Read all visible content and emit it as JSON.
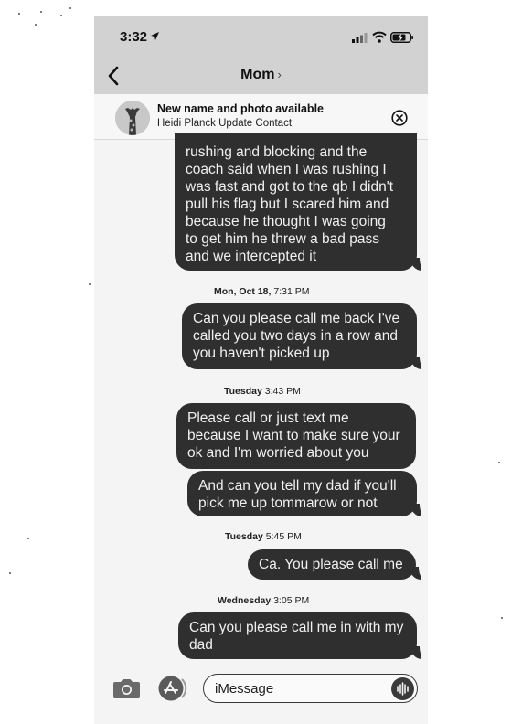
{
  "status_bar": {
    "time": "3:32"
  },
  "header": {
    "contact_name": "Mom",
    "chevron": "›"
  },
  "banner": {
    "title": "New name and photo available",
    "subtitle": "Heidi Planck Update Contact"
  },
  "messages": [
    {
      "type": "sent",
      "lines": [
        "rushing and blocking and the",
        "coach said when I was rushing I",
        "was fast and got to the qb I didn't",
        "pull his flag but I scared him and",
        "because he thought I was going",
        "to get him he threw a bad pass",
        "and we intercepted it"
      ]
    },
    {
      "type": "timestamp",
      "day": "Mon, Oct 18,",
      "time": "7:31 PM"
    },
    {
      "type": "sent",
      "lines": [
        "Can you please call me back I've",
        "called you two days in a row and",
        "you haven't picked up"
      ]
    },
    {
      "type": "timestamp",
      "day": "Tuesday",
      "time": "3:43 PM"
    },
    {
      "type": "sent",
      "lines": [
        "Please call or just text me",
        "because I want to make sure your",
        "ok and I'm worried about you"
      ]
    },
    {
      "type": "sent",
      "lines": [
        "And can you tell my dad if you'll",
        "pick me up tommarow or not"
      ]
    },
    {
      "type": "timestamp",
      "day": "Tuesday",
      "time": "5:45 PM"
    },
    {
      "type": "sent",
      "lines": [
        "Ca. You please call me"
      ]
    },
    {
      "type": "timestamp",
      "day": "Wednesday",
      "time": "3:05 PM"
    },
    {
      "type": "sent",
      "lines": [
        "Can you please call me in with my",
        "dad"
      ]
    }
  ],
  "input": {
    "placeholder": "iMessage"
  },
  "icons": {
    "location": "location-arrow-icon",
    "signal": "signal-bars-icon",
    "wifi": "wifi-icon",
    "battery": "battery-charging-icon",
    "back": "chevron-left-icon",
    "close": "close-circle-icon",
    "camera": "camera-icon",
    "appstore": "app-store-icon",
    "audio": "audio-waveform-icon"
  }
}
